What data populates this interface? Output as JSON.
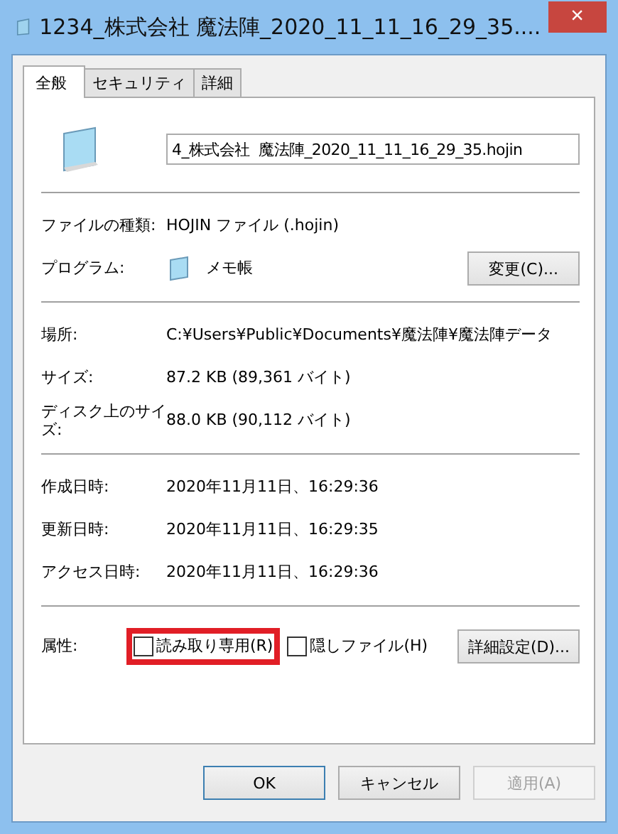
{
  "window": {
    "title": "1234_株式会社  魔法陣_2020_11_11_16_29_35....",
    "close": "×"
  },
  "tabs": [
    {
      "label": "全般",
      "selected": true
    },
    {
      "label": "セキュリティ",
      "selected": false
    },
    {
      "label": "詳細",
      "selected": false
    }
  ],
  "file_name": {
    "value": "4_株式会社  魔法陣_2020_11_11_16_29_35.hojin"
  },
  "sections": [
    [
      {
        "kind": "text",
        "label": "ファイルの種類:",
        "value": "HOJIN ファイル (.hojin)"
      },
      {
        "kind": "program",
        "label": "プログラム:",
        "value": "メモ帳",
        "button": "変更(C)..."
      }
    ],
    [
      {
        "kind": "text",
        "label": "場所:",
        "value": "C:¥Users¥Public¥Documents¥魔法陣¥魔法陣データ"
      },
      {
        "kind": "text",
        "label": "サイズ:",
        "value": "87.2 KB (89,361 バイト)"
      },
      {
        "kind": "text",
        "label": "ディスク上のサイズ:",
        "value": "88.0 KB (90,112 バイト)"
      }
    ],
    [
      {
        "kind": "text",
        "label": "作成日時:",
        "value": "2020年11月11日、16:29:36"
      },
      {
        "kind": "text",
        "label": "更新日時:",
        "value": "2020年11月11日、16:29:35"
      },
      {
        "kind": "text",
        "label": "アクセス日時:",
        "value": "2020年11月11日、16:29:36"
      }
    ]
  ],
  "attributes": {
    "label": "属性:",
    "checkboxes": [
      {
        "label": "読み取り専用(R)",
        "checked": false,
        "highlighted": true
      },
      {
        "label": "隠しファイル(H)",
        "checked": false,
        "highlighted": false
      }
    ],
    "button": "詳細設定(D)..."
  },
  "buttons": [
    {
      "label": "OK",
      "default": true,
      "disabled": false
    },
    {
      "label": "キャンセル",
      "default": false,
      "disabled": false
    },
    {
      "label": "適用(A)",
      "default": false,
      "disabled": true
    }
  ]
}
